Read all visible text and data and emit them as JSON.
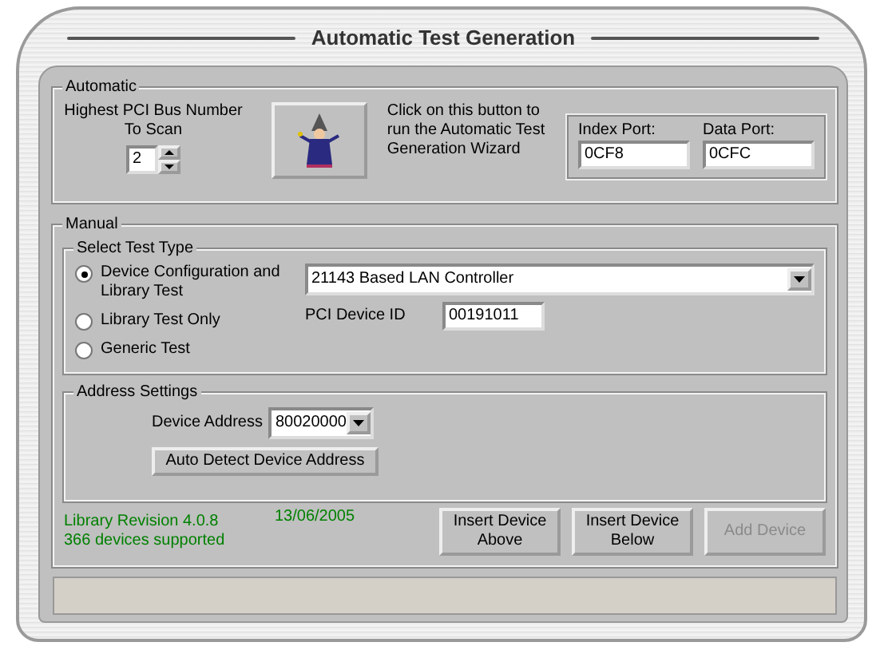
{
  "window": {
    "title": "Automatic Test Generation"
  },
  "automatic": {
    "label": "Automatic",
    "bus_label": "Highest PCI Bus Number To Scan",
    "bus_value": "2",
    "wizard_hint": "Click on this button to run the Automatic Test Generation Wizard",
    "ports": [
      {
        "label": "Index Port:",
        "value": "0CF8"
      },
      {
        "label": "Data Port:",
        "value": "0CFC"
      }
    ]
  },
  "manual": {
    "label": "Manual",
    "test_type": {
      "label": "Select Test Type",
      "options": [
        {
          "label": "Device Configuration and Library Test",
          "selected": true
        },
        {
          "label": "Library Test Only",
          "selected": false
        },
        {
          "label": "Generic Test",
          "selected": false
        }
      ],
      "device": "21143 Based LAN Controller",
      "pci_id_label": "PCI Device ID",
      "pci_id_value": "00191011"
    },
    "address": {
      "label": "Address Settings",
      "device_address_label": "Device Address",
      "device_address_value": "80020000",
      "auto_detect_button": "Auto Detect Device Address"
    }
  },
  "footer": {
    "revision": "Library Revision 4.0.8",
    "date": "13/06/2005",
    "devices": "366 devices supported",
    "buttons": [
      {
        "label": "Insert Device Above",
        "disabled": false
      },
      {
        "label": "Insert Device Below",
        "disabled": false
      },
      {
        "label": "Add Device",
        "disabled": true
      }
    ]
  }
}
